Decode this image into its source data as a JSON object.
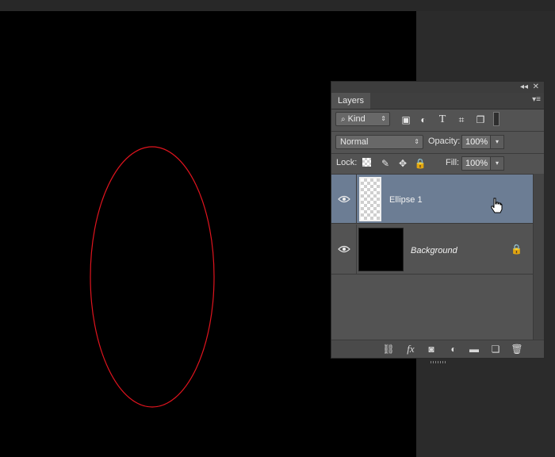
{
  "canvas": {
    "shape": "ellipse",
    "stroke_color": "#e0141e",
    "background": "#000000"
  },
  "panel": {
    "title_controls": {
      "collapse_icon": "double-chevron-left-icon",
      "close_icon": "close-icon",
      "collapse": "◂◂",
      "close": "✕"
    },
    "tab_label": "Layers",
    "menu_icon": "panel-menu-icon",
    "filter": {
      "kind_label": "Kind",
      "search_icon": "search-icon",
      "icons": [
        "image-filter-icon",
        "adjustment-filter-icon",
        "type-filter-icon",
        "shape-filter-icon",
        "smart-object-filter-icon",
        "filter-toggle-icon"
      ]
    },
    "blend": {
      "mode": "Normal",
      "opacity_label": "Opacity:",
      "opacity_value": "100%"
    },
    "lock": {
      "label": "Lock:",
      "fill_label": "Fill:",
      "fill_value": "100%",
      "icons": [
        "lock-transparent-pixels-icon",
        "lock-image-pixels-icon",
        "lock-position-icon",
        "lock-all-icon"
      ]
    },
    "layers": [
      {
        "name": "Ellipse 1",
        "selected": true,
        "thumbnail": "transparent",
        "visible": true
      },
      {
        "name": "Background",
        "selected": false,
        "thumbnail": "black",
        "visible": true,
        "locked": true,
        "italic": true
      }
    ],
    "bottom_icons": [
      "link-layers-icon",
      "fx-icon",
      "add-mask-icon",
      "new-adjustment-layer-icon",
      "new-group-icon",
      "new-layer-icon",
      "delete-layer-icon"
    ]
  }
}
